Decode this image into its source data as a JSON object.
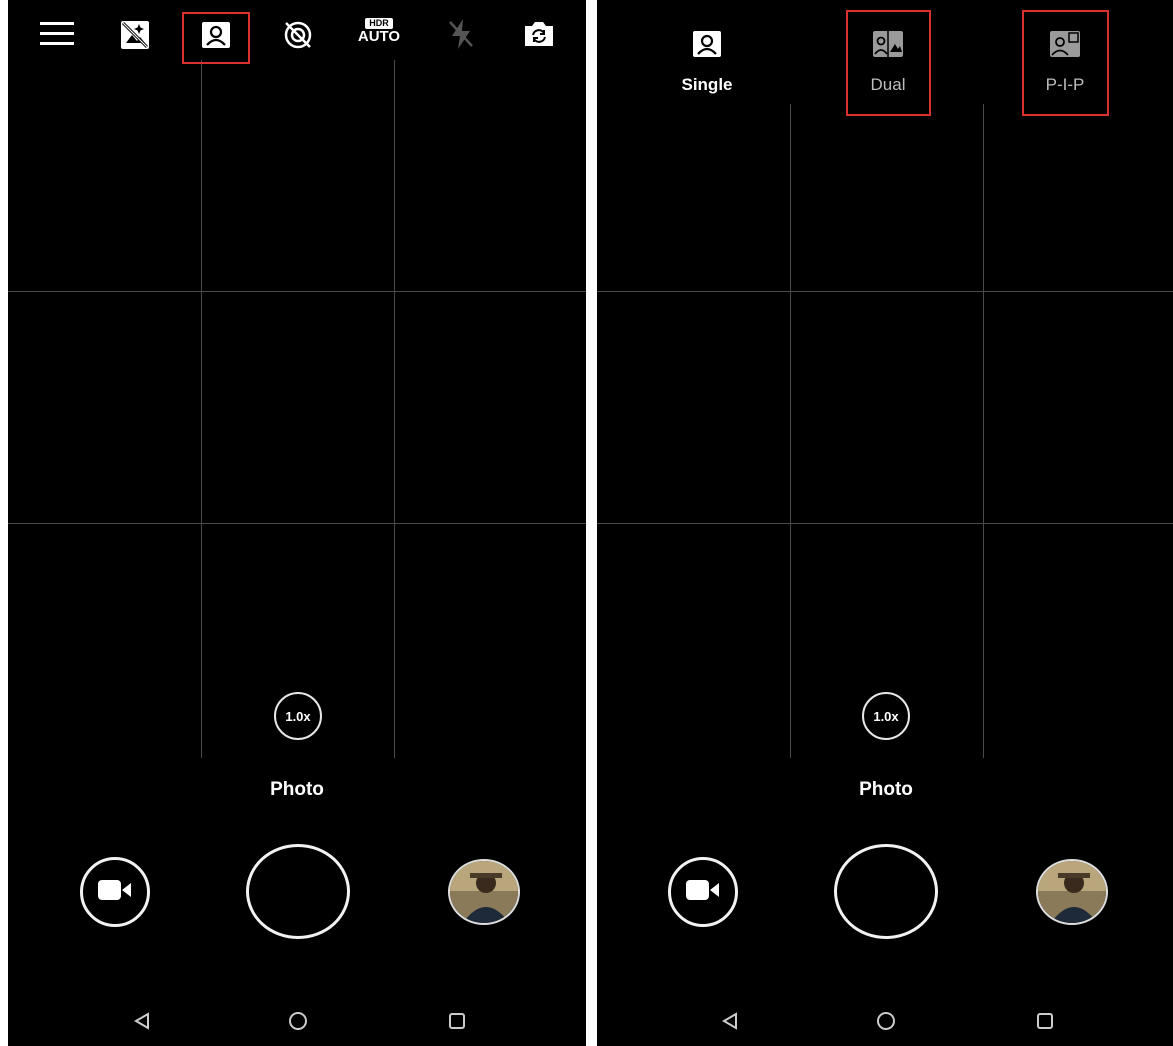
{
  "left": {
    "toolbar_icons": [
      "menu-icon",
      "filter-off-icon",
      "portrait-icon",
      "beauty-off-icon",
      "hdr-auto-icon",
      "flash-off-icon",
      "switch-camera-icon"
    ],
    "hdr_top": "HDR",
    "hdr_bottom": "AUTO",
    "zoom": "1.0x",
    "mode": "Photo"
  },
  "right": {
    "modes": [
      {
        "label": "Single",
        "icon": "single-portrait-icon"
      },
      {
        "label": "Dual",
        "icon": "dual-icon"
      },
      {
        "label": "P-I-P",
        "icon": "pip-icon"
      }
    ],
    "zoom": "1.0x",
    "mode": "Photo"
  },
  "colors": {
    "highlight": "#d9312b",
    "background": "#000000",
    "grid": "#4a4a4a"
  }
}
